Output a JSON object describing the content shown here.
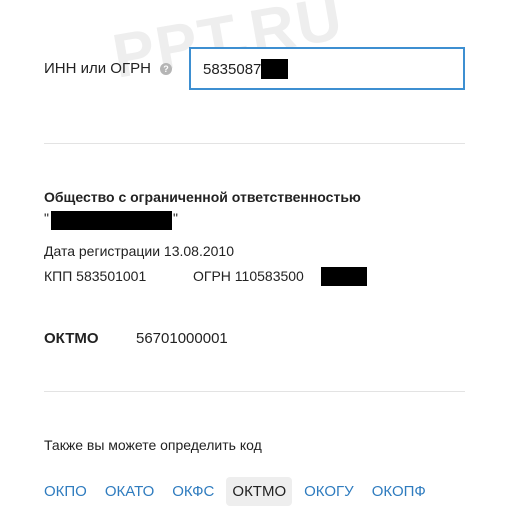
{
  "watermark": "PPT.RU",
  "search": {
    "label": "ИНН или ОГРН",
    "help_icon": "question-icon",
    "value": "5835087"
  },
  "company": {
    "type": "Общество с ограниченной ответственностью",
    "name_open_quote": "\"",
    "name_close_quote": "\"",
    "registration": "Дата регистрации 13.08.2010",
    "kpp": "КПП 583501001",
    "ogrn": "ОГРН 110583500"
  },
  "oktmo": {
    "label": "ОКТМО",
    "value": "56701000001"
  },
  "also_text": "Также вы можете определить код",
  "code_tabs": [
    {
      "label": "ОКПО",
      "active": false
    },
    {
      "label": "ОКАТО",
      "active": false
    },
    {
      "label": "ОКФС",
      "active": false
    },
    {
      "label": "ОКТМО",
      "active": true
    },
    {
      "label": "ОКОГУ",
      "active": false
    },
    {
      "label": "ОКОПФ",
      "active": false
    }
  ],
  "colors": {
    "accent": "#3d8fd1",
    "link": "#2f7cbf",
    "active_tab_bg": "#eeeeee",
    "redaction": "#000000"
  }
}
